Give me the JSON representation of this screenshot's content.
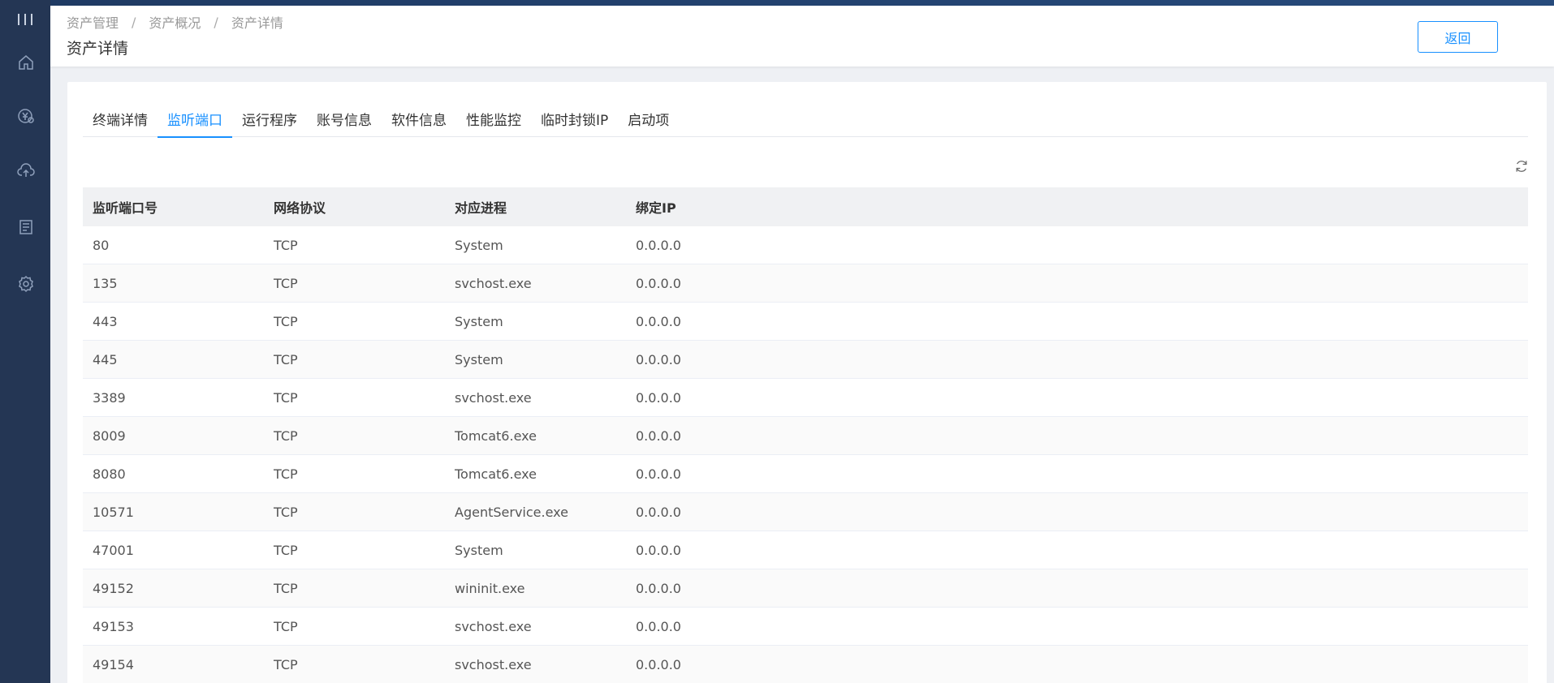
{
  "breadcrumb": [
    "资产管理",
    "资产概况",
    "资产详情"
  ],
  "page_title": "资产详情",
  "back_label": "返回",
  "sidebar": {
    "icons": [
      "home-icon",
      "finance-icon",
      "cloud-upload-icon",
      "report-icon",
      "settings-icon"
    ]
  },
  "tabs": [
    {
      "label": "终端详情",
      "active": false
    },
    {
      "label": "监听端口",
      "active": true
    },
    {
      "label": "运行程序",
      "active": false
    },
    {
      "label": "账号信息",
      "active": false
    },
    {
      "label": "软件信息",
      "active": false
    },
    {
      "label": "性能监控",
      "active": false
    },
    {
      "label": "临时封锁IP",
      "active": false
    },
    {
      "label": "启动项",
      "active": false
    }
  ],
  "table": {
    "columns": [
      "监听端口号",
      "网络协议",
      "对应进程",
      "绑定IP"
    ],
    "rows": [
      [
        "80",
        "TCP",
        "System",
        "0.0.0.0"
      ],
      [
        "135",
        "TCP",
        "svchost.exe",
        "0.0.0.0"
      ],
      [
        "443",
        "TCP",
        "System",
        "0.0.0.0"
      ],
      [
        "445",
        "TCP",
        "System",
        "0.0.0.0"
      ],
      [
        "3389",
        "TCP",
        "svchost.exe",
        "0.0.0.0"
      ],
      [
        "8009",
        "TCP",
        "Tomcat6.exe",
        "0.0.0.0"
      ],
      [
        "8080",
        "TCP",
        "Tomcat6.exe",
        "0.0.0.0"
      ],
      [
        "10571",
        "TCP",
        "AgentService.exe",
        "0.0.0.0"
      ],
      [
        "47001",
        "TCP",
        "System",
        "0.0.0.0"
      ],
      [
        "49152",
        "TCP",
        "wininit.exe",
        "0.0.0.0"
      ],
      [
        "49153",
        "TCP",
        "svchost.exe",
        "0.0.0.0"
      ],
      [
        "49154",
        "TCP",
        "svchost.exe",
        "0.0.0.0"
      ]
    ]
  },
  "colors": {
    "sidebar_bg": "#243654",
    "accent": "#1890ff"
  }
}
